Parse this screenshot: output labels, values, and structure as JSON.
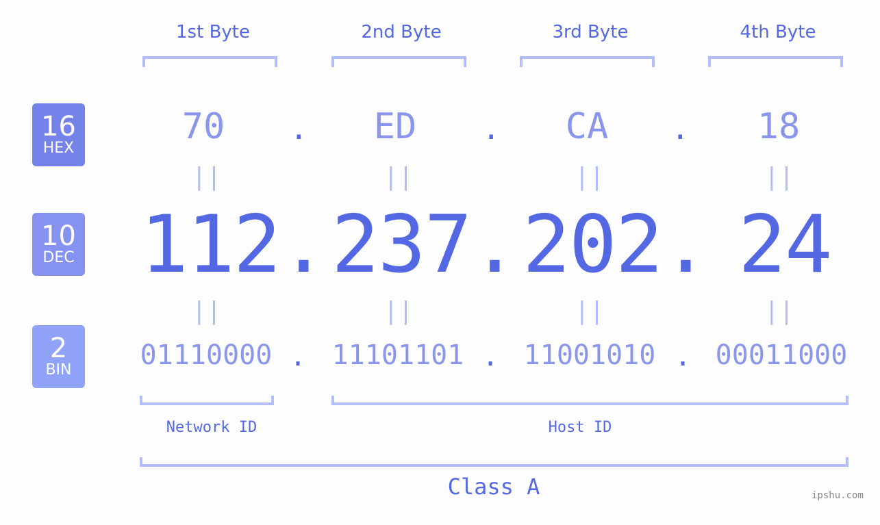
{
  "bytes": {
    "headers": [
      "1st Byte",
      "2nd Byte",
      "3rd Byte",
      "4th Byte"
    ],
    "hex": [
      "70",
      "ED",
      "CA",
      "18"
    ],
    "dec": [
      "112",
      "237",
      "202",
      "24"
    ],
    "bin": [
      "01110000",
      "11101101",
      "11001010",
      "00011000"
    ]
  },
  "separator": ".",
  "equals": "||",
  "badges": {
    "hex": {
      "num": "16",
      "label": "HEX",
      "color": "#7582ea"
    },
    "dec": {
      "num": "10",
      "label": "DEC",
      "color": "#8592f0"
    },
    "bin": {
      "num": "2",
      "label": "BIN",
      "color": "#91a3f8"
    }
  },
  "labels": {
    "network_id": "Network ID",
    "host_id": "Host ID",
    "class": "Class A"
  },
  "watermark": "ipshu.com",
  "colors": {
    "accent": "#5468e4",
    "light": "#8a95ec",
    "bracket": "#b3bdf6"
  }
}
